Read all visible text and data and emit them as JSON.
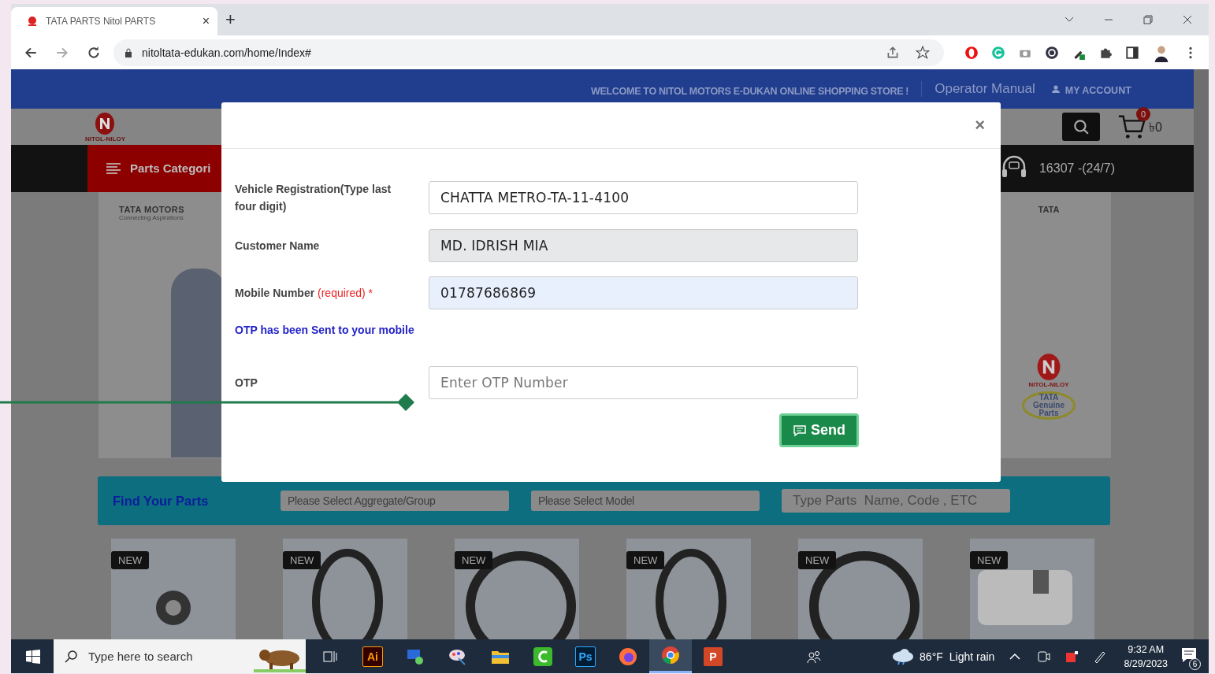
{
  "browser": {
    "tab": {
      "title": "TATA PARTS Nitol PARTS",
      "close": "×"
    },
    "new_tab": "+",
    "url": "nitoltata-edukan.com/home/Index#"
  },
  "site": {
    "top_bar": {
      "welcome": "WELCOME TO NITOL MOTORS E-DUKAN ONLINE SHOPPING STORE !",
      "manual": "Operator Manual",
      "account": "MY ACCOUNT"
    },
    "logo_text": "NITOL-NILOY",
    "cart": {
      "count": "0",
      "total": "৳0"
    },
    "categories": "Parts Categori",
    "hotline": "16307 -(24/7)",
    "banner": {
      "left_logo": "TATA MOTORS",
      "left_tagline": "Connecting Aspirations",
      "right_logo": "TATA",
      "badge_brand": "NITOL-NILOY",
      "badge_text": "TATA Genuine Parts"
    },
    "find_parts": {
      "title": "Find Your Parts",
      "selects": [
        "Please Select Aggregate/Group",
        "Please Select Model"
      ],
      "search_placeholder": "Type Parts  Name, Code , ETC"
    },
    "products": [
      {
        "badge": "NEW",
        "kind": "cap"
      },
      {
        "badge": "NEW",
        "kind": "seal"
      },
      {
        "badge": "NEW",
        "kind": "ring"
      },
      {
        "badge": "NEW",
        "kind": "seal"
      },
      {
        "badge": "NEW",
        "kind": "ring"
      },
      {
        "badge": "NEW",
        "kind": "photo"
      }
    ]
  },
  "modal": {
    "close": "×",
    "fields": [
      {
        "label": "Vehicle Registration(Type last four digit)",
        "value": "CHATTA METRO-TA-11-4100",
        "disabled": false,
        "autofilled": false
      },
      {
        "label": "Customer Name",
        "value": "MD. IDRISH MIA",
        "disabled": true,
        "autofilled": false
      },
      {
        "label": "Mobile Number",
        "required_note": "(required) *",
        "value": "01787686869",
        "disabled": false,
        "autofilled": true
      }
    ],
    "otp_message": "OTP has been Sent to your mobile",
    "otp": {
      "label": "OTP",
      "placeholder": "Enter OTP Number"
    },
    "send": "Send"
  },
  "taskbar": {
    "search_placeholder": "Type here to search",
    "apps": [
      {
        "kind": "taskview",
        "active": false
      },
      {
        "kind": "ai",
        "label": "Ai",
        "active": false
      },
      {
        "kind": "remote",
        "active": false
      },
      {
        "kind": "paint",
        "active": false
      },
      {
        "kind": "folder",
        "active": false
      },
      {
        "kind": "camtasia",
        "active": false
      },
      {
        "kind": "ps",
        "label": "Ps",
        "active": false
      },
      {
        "kind": "firefox",
        "active": false
      },
      {
        "kind": "chrome",
        "active": true
      },
      {
        "kind": "ppt",
        "label": "P",
        "active": false
      }
    ],
    "weather": {
      "temp": "86°F",
      "condition": "Light rain"
    },
    "time": "9:32 AM",
    "date": "8/29/2023",
    "notifications": "6"
  }
}
